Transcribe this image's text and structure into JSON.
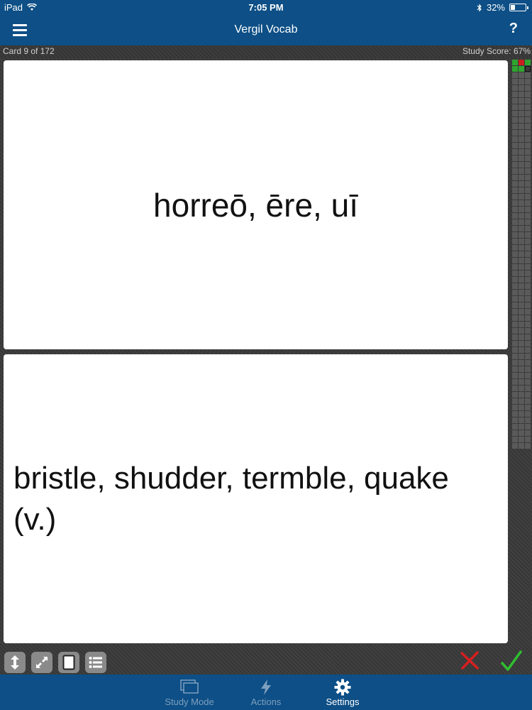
{
  "status_bar": {
    "device": "iPad",
    "time": "7:05 PM",
    "battery": "32%",
    "battery_level": 0.32
  },
  "navbar": {
    "title": "Vergil Vocab",
    "help": "?"
  },
  "infobar": {
    "card_count": "Card 9 of 172",
    "study_score": "Study Score: 67%"
  },
  "card": {
    "front": "horreō, ēre, uī",
    "back": "bristle, shudder, termble, quake (v.)"
  },
  "progress_grid": {
    "cells": [
      "green",
      "red",
      "green",
      "green",
      "green",
      "current"
    ],
    "total_cells": 183
  },
  "toolbar": {
    "resize_icon": "vertical-resize-icon",
    "expand_icon": "expand-icon",
    "card_icon": "single-card-icon",
    "list_icon": "list-icon",
    "wrong_icon": "x-mark-icon",
    "right_icon": "check-mark-icon"
  },
  "tabbar": {
    "tabs": [
      {
        "label": "Study Mode",
        "icon": "cards-icon",
        "active": false
      },
      {
        "label": "Actions",
        "icon": "lightning-icon",
        "active": false
      },
      {
        "label": "Settings",
        "icon": "gear-icon",
        "active": true
      }
    ]
  },
  "colors": {
    "brand": "#0d4f86",
    "correct": "#2fa52f",
    "wrong": "#c81f1f"
  }
}
